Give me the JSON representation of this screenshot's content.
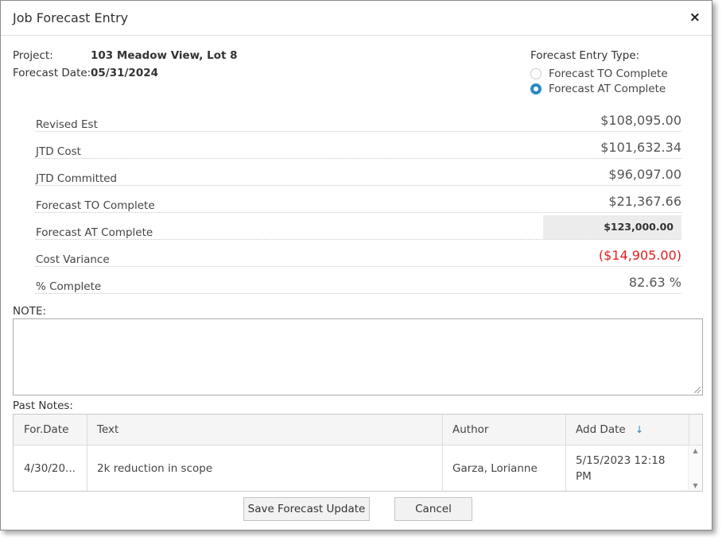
{
  "dialog": {
    "title": "Job Forecast Entry",
    "close_icon": "×"
  },
  "header": {
    "project_label": "Project:",
    "project_value": "103 Meadow View, Lot 8",
    "forecast_date_label": "Forecast Date:",
    "forecast_date_value": "05/31/2024",
    "entry_type_label": "Forecast Entry Type:",
    "entry_type_options": [
      {
        "label": "Forecast TO Complete",
        "selected": false
      },
      {
        "label": "Forecast AT Complete",
        "selected": true
      }
    ]
  },
  "summary": [
    {
      "label": "Revised Est",
      "value": "$108,095.00"
    },
    {
      "label": "JTD Cost",
      "value": "$101,632.34"
    },
    {
      "label": "JTD Committed",
      "value": "$96,097.00"
    },
    {
      "label": "Forecast TO Complete",
      "value": "$21,367.66"
    },
    {
      "label": "Forecast AT Complete",
      "value": "$123,000.00"
    },
    {
      "label": "Cost Variance",
      "value": "($14,905.00)"
    },
    {
      "label": "% Complete",
      "value": "82.63 %"
    }
  ],
  "note": {
    "label": "NOTE:",
    "value": ""
  },
  "past_notes": {
    "label": "Past Notes:",
    "columns": [
      "For.Date",
      "Text",
      "Author",
      "Add Date"
    ],
    "sort_icon": "↓",
    "rows": [
      {
        "for_date": "4/30/20...",
        "text": "2k reduction in scope",
        "author": "Garza, Lorianne",
        "add_date": "5/15/2023 12:18 PM"
      }
    ]
  },
  "buttons": {
    "save": "Save Forecast Update",
    "cancel": "Cancel"
  },
  "colors": {
    "accent": "#2a8ac4",
    "negative": "#e02020"
  }
}
